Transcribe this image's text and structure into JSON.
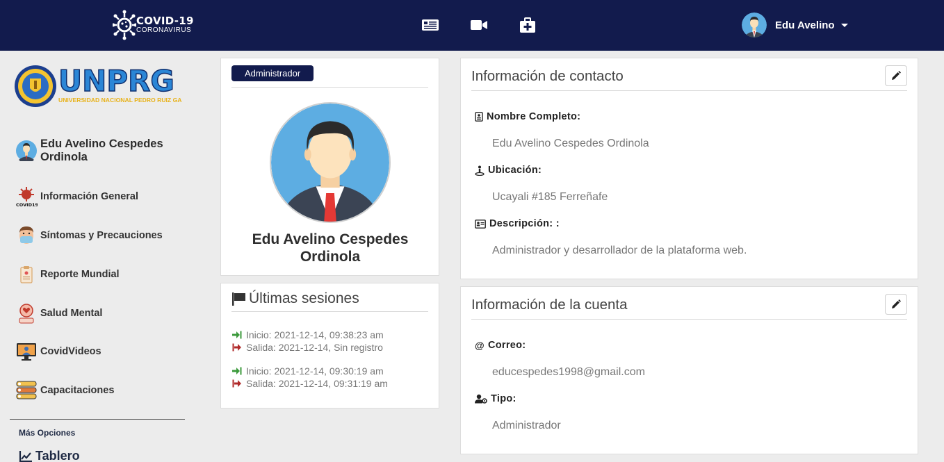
{
  "navbar": {
    "brand_title": "COVID-19",
    "brand_subtitle": "CORONAVIRUS",
    "icons": [
      "newspaper-icon",
      "video-icon",
      "medkit-icon"
    ],
    "user_name": "Edu Avelino"
  },
  "sidebar": {
    "logo_text": "UNPRG",
    "logo_subtitle": "UNIVERSIDAD NACIONAL PEDRO RUIZ GALLO",
    "user_name": "Edu Avelino Cespedes Ordinola",
    "items": [
      {
        "label": "Información General",
        "icon": "covid-icon"
      },
      {
        "label": "Síntomas y Precauciones",
        "icon": "mask-person-icon"
      },
      {
        "label": "Reporte Mundial",
        "icon": "clipboard-icon"
      },
      {
        "label": "Salud Mental",
        "icon": "heart-head-icon"
      },
      {
        "label": "CovidVideos",
        "icon": "monitor-icon"
      },
      {
        "label": "Capacitaciones",
        "icon": "list-icon"
      }
    ],
    "more_label": "Más Opciones",
    "dashboard_label": "Tablero"
  },
  "profile": {
    "role_badge": "Administrador",
    "name": "Edu Avelino Cespedes Ordinola"
  },
  "sessions": {
    "title": "Últimas sesiones",
    "entries": [
      {
        "login": "Inicio: 2021-12-14, 09:38:23 am",
        "logout": "Salida: 2021-12-14, Sin registro"
      },
      {
        "login": "Inicio: 2021-12-14, 09:30:19 am",
        "logout": "Salida: 2021-12-14, 09:31:19 am"
      }
    ]
  },
  "contact": {
    "title": "Información de contacto",
    "fields": [
      {
        "label": "Nombre Completo:",
        "value": "Edu Avelino Cespedes Ordinola"
      },
      {
        "label": "Ubicación:",
        "value": "Ucayali #185 Ferreñafe"
      },
      {
        "label": "Descripción: :",
        "value": "Administrador y desarrollador de la plataforma web."
      }
    ]
  },
  "account": {
    "title": "Información de la cuenta",
    "fields": [
      {
        "label": "Correo:",
        "value": "educespedes1998@gmail.com"
      },
      {
        "label": "Tipo:",
        "value": "Administrador"
      }
    ]
  },
  "colors": {
    "navbar": "#121b4d",
    "login_arrow": "#3c9a3c",
    "logout_arrow": "#b02a2a"
  }
}
